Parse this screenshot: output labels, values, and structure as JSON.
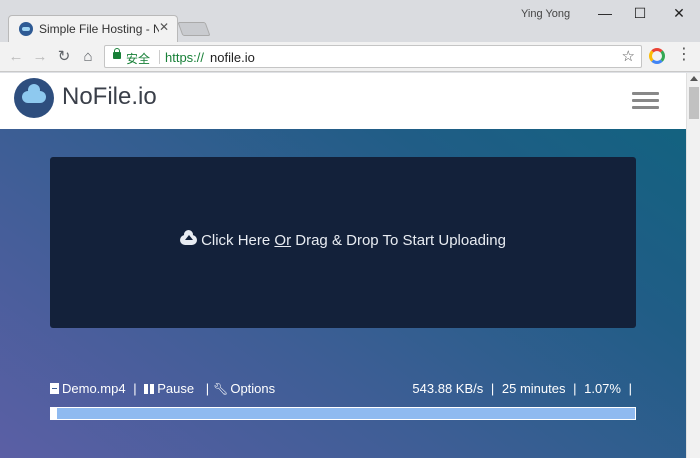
{
  "browser": {
    "tab_title": "Simple File Hosting - No",
    "tab_close": "✕",
    "profile_name": "Ying Yong",
    "window_controls": {
      "minimize": "—",
      "maximize": "☐",
      "close": "✕"
    },
    "nav": {
      "back": "←",
      "forward": "→",
      "reload": "↻",
      "home": "⌂"
    },
    "security_label": "安全",
    "url_protocol": "https://",
    "url_host": "nofile.io",
    "bookmark_star": "☆",
    "menu": "⋮"
  },
  "site": {
    "logo_text": "NoFile.io"
  },
  "dropzone": {
    "text_before": "Click Here ",
    "text_or": "Or",
    "text_after": " Drag & Drop To Start Uploading"
  },
  "upload": {
    "file_name": "Demo.mp4",
    "pause_label": "Pause",
    "options_label": "Options",
    "separator": "|",
    "speed": "543.88 KB/s",
    "eta": "25 minutes",
    "percent": "1.07%",
    "progress_fraction": 0.0107
  }
}
